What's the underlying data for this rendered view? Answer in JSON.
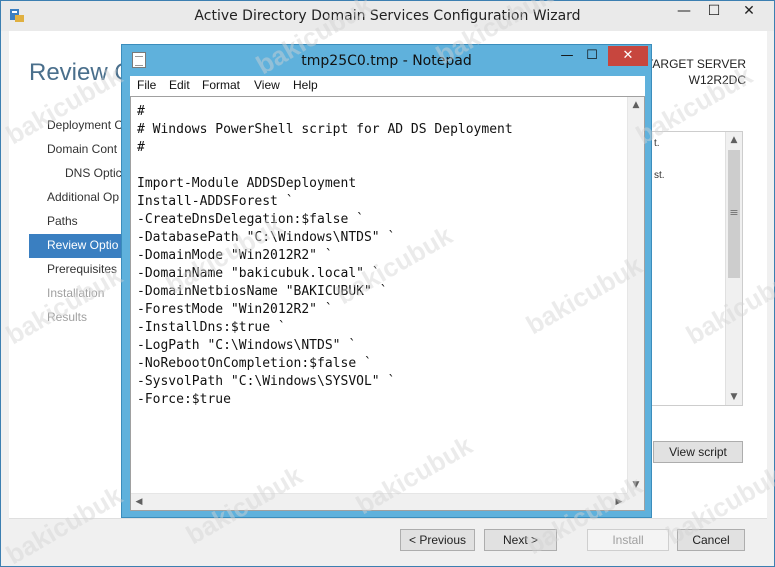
{
  "wizard": {
    "title": "Active Directory Domain Services Configuration Wizard",
    "heading": "Review O",
    "target_server_label": "TARGET SERVER",
    "target_server_name": "W12R2DC",
    "nav": [
      {
        "label": "Deployment C",
        "state": "normal",
        "sub": false
      },
      {
        "label": "Domain Cont",
        "state": "normal",
        "sub": false
      },
      {
        "label": "DNS Optic",
        "state": "normal",
        "sub": true
      },
      {
        "label": "Additional Op",
        "state": "normal",
        "sub": false
      },
      {
        "label": "Paths",
        "state": "normal",
        "sub": false
      },
      {
        "label": "Review Optio",
        "state": "active",
        "sub": false
      },
      {
        "label": "Prerequisites",
        "state": "normal",
        "sub": false
      },
      {
        "label": "Installation",
        "state": "disabled",
        "sub": false
      },
      {
        "label": "Results",
        "state": "disabled",
        "sub": false
      }
    ],
    "results_fragments": [
      "t.",
      "st."
    ],
    "view_script_label": "View script",
    "buttons": {
      "previous": "< Previous",
      "next": "Next >",
      "install": "Install",
      "cancel": "Cancel"
    },
    "window_controls": {
      "minimize": "—",
      "maximize": "☐",
      "close": "✕"
    }
  },
  "notepad": {
    "title": "tmp25C0.tmp - Notepad",
    "menu": [
      "File",
      "Edit",
      "Format",
      "View",
      "Help"
    ],
    "window_controls": {
      "minimize": "—",
      "maximize": "☐",
      "close": "✕"
    },
    "lines": [
      "#",
      "# Windows PowerShell script for AD DS Deployment",
      "#",
      "",
      "Import-Module ADDSDeployment",
      "Install-ADDSForest `",
      "-CreateDnsDelegation:$false `",
      "-DatabasePath \"C:\\Windows\\NTDS\" `",
      "-DomainMode \"Win2012R2\" `",
      "-DomainName \"bakicubuk.local\" `",
      "-DomainNetbiosName \"BAKICUBUK\" `",
      "-ForestMode \"Win2012R2\" `",
      "-InstallDns:$true `",
      "-LogPath \"C:\\Windows\\NTDS\" `",
      "-NoRebootOnCompletion:$false `",
      "-SysvolPath \"C:\\Windows\\SYSVOL\" `",
      "-Force:$true"
    ]
  },
  "watermark": "bakicubuk"
}
